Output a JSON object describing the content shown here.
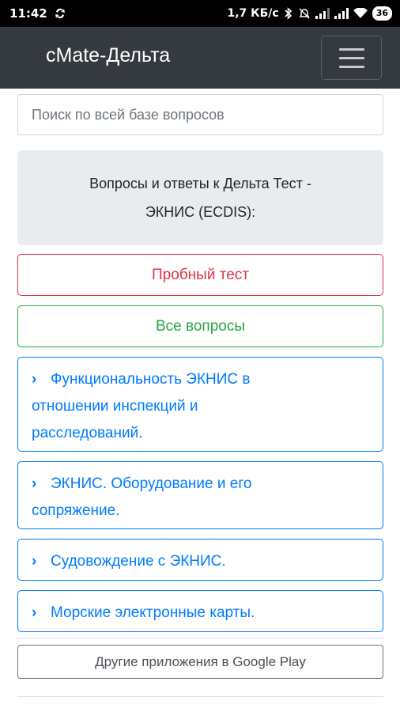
{
  "status_bar": {
    "time": "11:42",
    "speed": "1,7 КБ/с",
    "battery": "36"
  },
  "navbar": {
    "brand": "cMate-Дельта",
    "toggler_icon": "hamburger-menu-icon"
  },
  "search": {
    "placeholder": "Поиск по всей базе вопросов"
  },
  "intro": {
    "line1": "Вопросы и ответы к Дельта Тест -",
    "line2": "ЭКНИС (ECDIS):"
  },
  "buttons": {
    "trial_test": "Пробный тест",
    "all_questions": "Все вопросы"
  },
  "topics": [
    {
      "icon": "chevron-right-icon",
      "line1": "Функциональность ЭКНИС в",
      "line2": "отношении инспекций и",
      "line3": "расследований."
    },
    {
      "icon": "chevron-right-icon",
      "line1": "ЭКНИС. Оборудование и его",
      "line2": "сопряжение."
    },
    {
      "icon": "chevron-right-icon",
      "line1": "Судовождение с ЭКНИС."
    },
    {
      "icon": "chevron-right-icon",
      "line1": "Морские электронные карты."
    }
  ],
  "footer": {
    "other_apps": "Другие приложения в Google Play"
  },
  "colors": {
    "navbar": "#343a40",
    "danger": "#dc3545",
    "success": "#28a745",
    "primary": "#007bff",
    "jumbotron": "#e9ecef"
  }
}
